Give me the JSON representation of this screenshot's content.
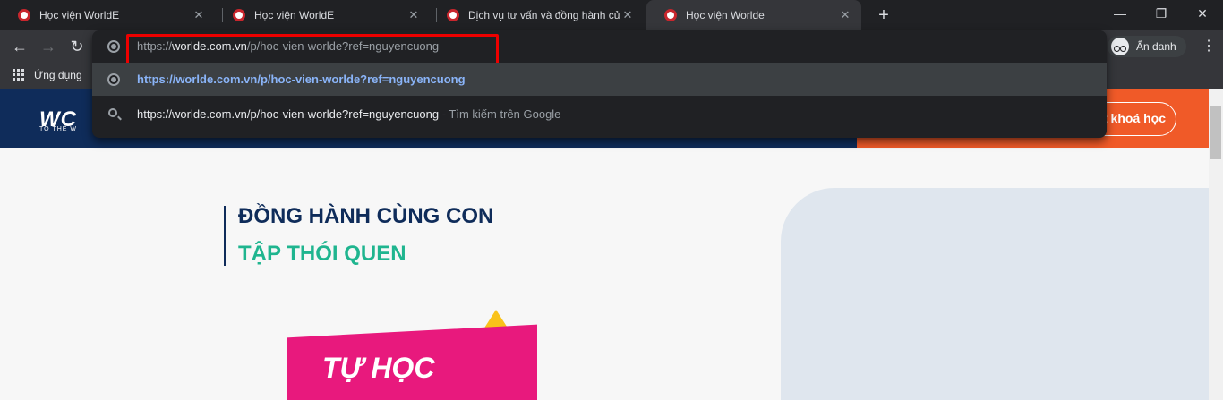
{
  "tabs": [
    {
      "title": "Học viện WorldE",
      "active": false
    },
    {
      "title": "Học viện WorldE",
      "active": false
    },
    {
      "title": "Dịch vụ tư vấn và đồng hành của",
      "active": false
    },
    {
      "title": "Học viện Worlde",
      "active": true
    }
  ],
  "newtab_label": "+",
  "window_controls": {
    "minimize": "—",
    "maximize": "❐",
    "close": "✕"
  },
  "nav": {
    "back": "←",
    "forward": "→",
    "reload": "↻"
  },
  "omnibox": {
    "url_scheme": "https://",
    "url_host": "worlde.com.vn",
    "url_path": "/p/hoc-vien-worlde?ref=nguyencuong",
    "suggestions": [
      {
        "text": "https://worlde.com.vn/p/hoc-vien-worlde?ref=nguyencuong",
        "type": "url",
        "icon": "globe-icon"
      },
      {
        "text": "https://worlde.com.vn/p/hoc-vien-worlde?ref=nguyencuong",
        "suffix": " - Tìm kiếm trên Google",
        "type": "search",
        "icon": "search-icon"
      }
    ]
  },
  "incognito": {
    "label": "Ẩn danh"
  },
  "menu": "⋮",
  "bookmarks": {
    "apps_label": "Ứng dụng"
  },
  "site": {
    "logo": "WC",
    "logo_sub": "TO THE W",
    "course_button": "t khoá học",
    "hero_line1": "ĐỒNG HÀNH CÙNG CON",
    "hero_line2": "TẬP THÓI QUEN",
    "card_text": "TỰ HỌC"
  },
  "colors": {
    "accent_red": "#e00000",
    "brand_navy": "#0f2c5a",
    "brand_green": "#1fb58f",
    "brand_orange": "#f05a28",
    "brand_pink": "#e8197d"
  }
}
